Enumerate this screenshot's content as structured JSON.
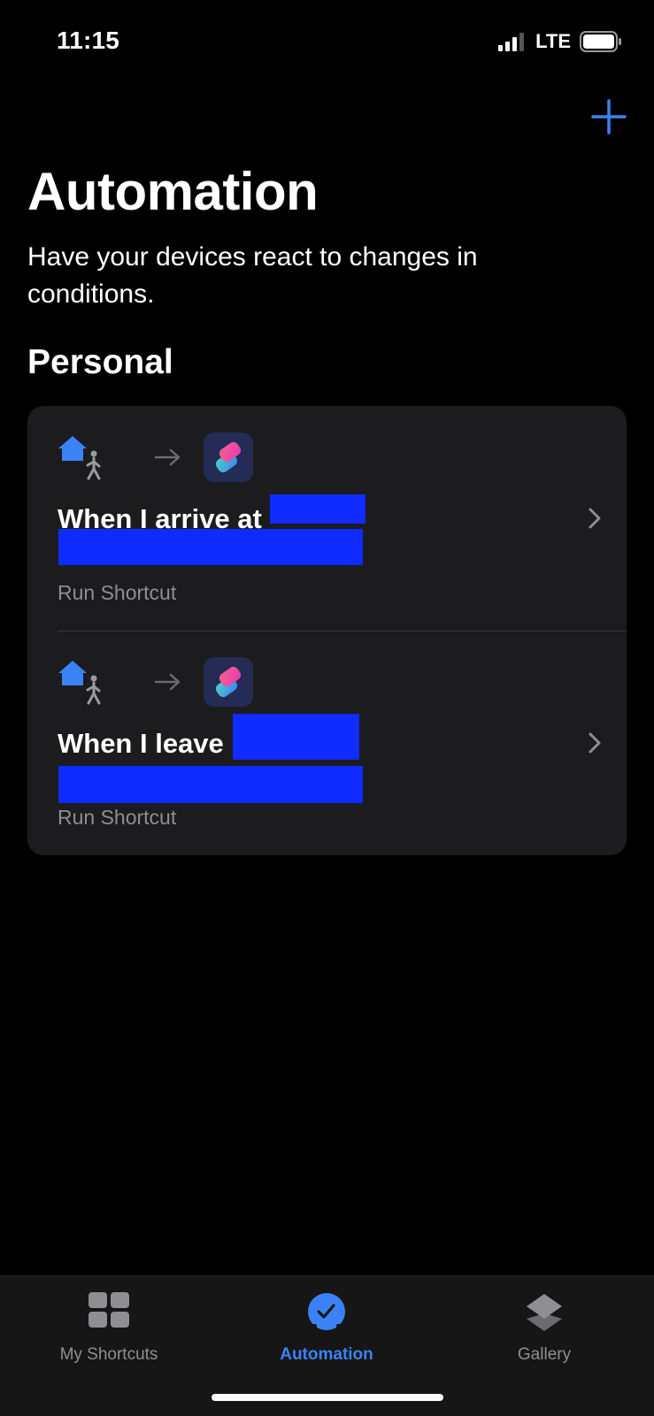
{
  "status_bar": {
    "time": "11:15",
    "network": "LTE",
    "signal_bars": 3,
    "battery_level": 0.9
  },
  "header": {
    "add_icon": "plus-icon",
    "title": "Automation",
    "subtitle": "Have your devices react to changes in conditions."
  },
  "section": {
    "heading": "Personal"
  },
  "automations": [
    {
      "title": "When I arrive at",
      "subtitle": "Run Shortcut",
      "trigger_icon": "home-person-icon",
      "app_icon": "shortcuts-app-icon"
    },
    {
      "title": "When I leave",
      "subtitle": "Run Shortcut",
      "trigger_icon": "home-person-icon",
      "app_icon": "shortcuts-app-icon"
    }
  ],
  "tab_bar": {
    "tabs": [
      {
        "label": "My Shortcuts",
        "icon": "grid-icon",
        "selected": false
      },
      {
        "label": "Automation",
        "icon": "clock-check-icon",
        "selected": true
      },
      {
        "label": "Gallery",
        "icon": "layers-icon",
        "selected": false
      }
    ]
  },
  "colors": {
    "accent": "#3b82f6",
    "background": "#000000",
    "card": "#1c1c1e",
    "redaction": "#0f2bff",
    "secondary_text": "#8e8e93"
  }
}
